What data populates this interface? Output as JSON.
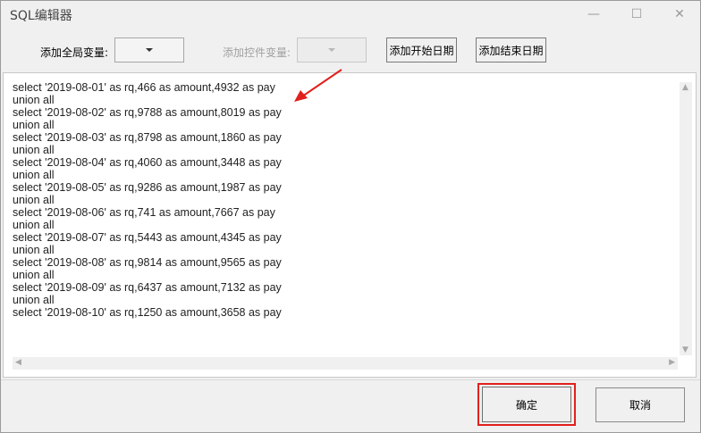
{
  "window": {
    "title": "SQL编辑器",
    "minimize_glyph": "—",
    "maximize_glyph": "☐",
    "close_glyph": "✕"
  },
  "toolbar": {
    "global_var_label": "添加全局变量:",
    "control_var_label": "添加控件变量:",
    "add_start_date": "添加开始日期",
    "add_end_date": "添加结束日期"
  },
  "editor": {
    "sql_text": "select '2019-08-01' as rq,466 as amount,4932 as pay\nunion all\nselect '2019-08-02' as rq,9788 as amount,8019 as pay\nunion all\nselect '2019-08-03' as rq,8798 as amount,1860 as pay\nunion all\nselect '2019-08-04' as rq,4060 as amount,3448 as pay\nunion all\nselect '2019-08-05' as rq,9286 as amount,1987 as pay\nunion all\nselect '2019-08-06' as rq,741 as amount,7667 as pay\nunion all\nselect '2019-08-07' as rq,5443 as amount,4345 as pay\nunion all\nselect '2019-08-08' as rq,9814 as amount,9565 as pay\nunion all\nselect '2019-08-09' as rq,6437 as amount,7132 as pay\nunion all\nselect '2019-08-10' as rq,1250 as amount,3658 as pay"
  },
  "footer": {
    "ok": "确定",
    "cancel": "取消"
  },
  "colors": {
    "annotation_red": "#e0201c"
  },
  "icons": {
    "dropdown": "chevron-down-icon",
    "scroll_up": "chevron-up-icon",
    "scroll_down": "chevron-down-icon",
    "scroll_left": "chevron-left-icon",
    "scroll_right": "chevron-right-icon"
  }
}
